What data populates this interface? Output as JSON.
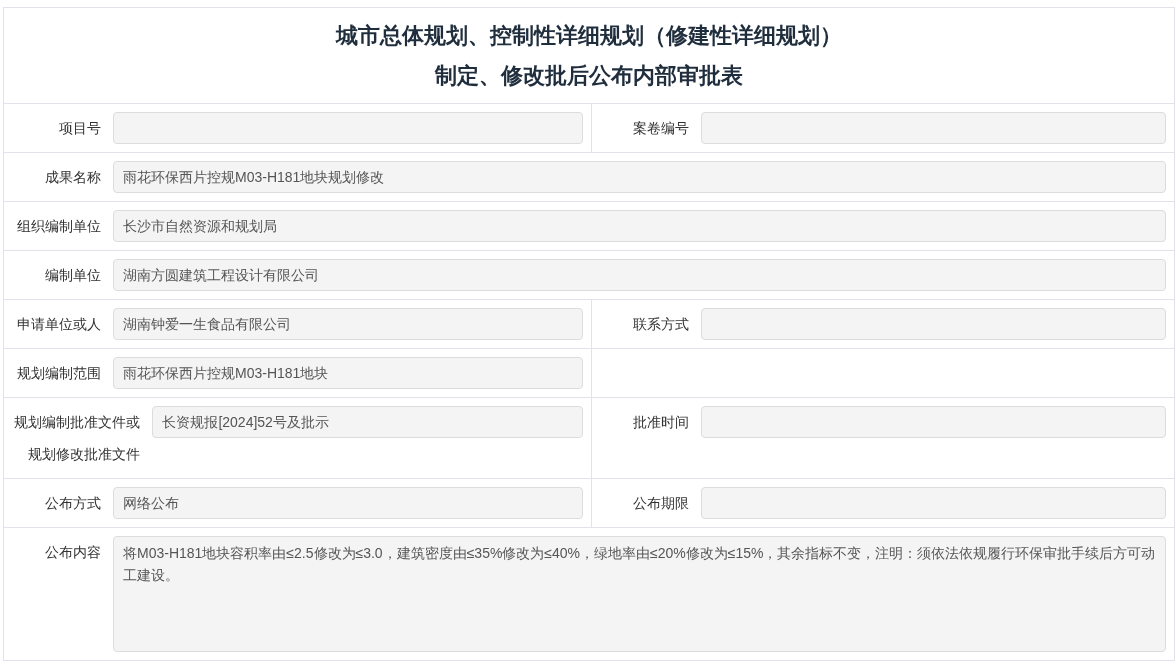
{
  "title_lines": [
    "城市总体规划、控制性详细规划（修建性详细规划）",
    "制定、修改批后公布内部审批表"
  ],
  "rows": [
    {
      "fields": [
        {
          "kind": "half",
          "label": "项目号"
        },
        {
          "kind": "half",
          "label": "案卷编号"
        }
      ]
    },
    {
      "fields": [
        {
          "kind": "wide",
          "label": "成果名称",
          "value": "雨花环保西片控规M03-H181地块规划修改"
        }
      ]
    },
    {
      "fields": [
        {
          "kind": "wide",
          "label": "组织编制单位",
          "value": "长沙市自然资源和规划局"
        }
      ]
    },
    {
      "fields": [
        {
          "kind": "wide",
          "label": "编制单位",
          "value": "湖南方圆建筑工程设计有限公司"
        }
      ]
    },
    {
      "fields": [
        {
          "kind": "half",
          "label": "申请单位或人",
          "value": "湖南钟爱一生食品有限公司"
        },
        {
          "kind": "half",
          "label": "联系方式"
        }
      ]
    },
    {
      "fields": [
        {
          "kind": "half",
          "label": "规划编制范围",
          "value": "雨花环保西片控规M03-H181地块"
        }
      ]
    },
    {
      "fields": [
        {
          "kind": "half",
          "label": "规划编制批准文件或规划修改批准文件",
          "value": "长资规报[2024]52号及批示"
        },
        {
          "kind": "half",
          "label": "批准时间"
        }
      ]
    },
    {
      "fields": [
        {
          "kind": "half",
          "label": "公布方式",
          "value": "网络公布"
        },
        {
          "kind": "half",
          "label": "公布期限"
        }
      ]
    },
    {
      "fields": [
        {
          "kind": "area",
          "label": "公布内容",
          "value": "将M03-H181地块容积率由≤2.5修改为≤3.0，建筑密度由≤35%修改为≤40%，绿地率由≤20%修改为≤15%，其余指标不变，注明：须依法依规履行环保审批手续后方可动工建设。"
        }
      ]
    }
  ]
}
